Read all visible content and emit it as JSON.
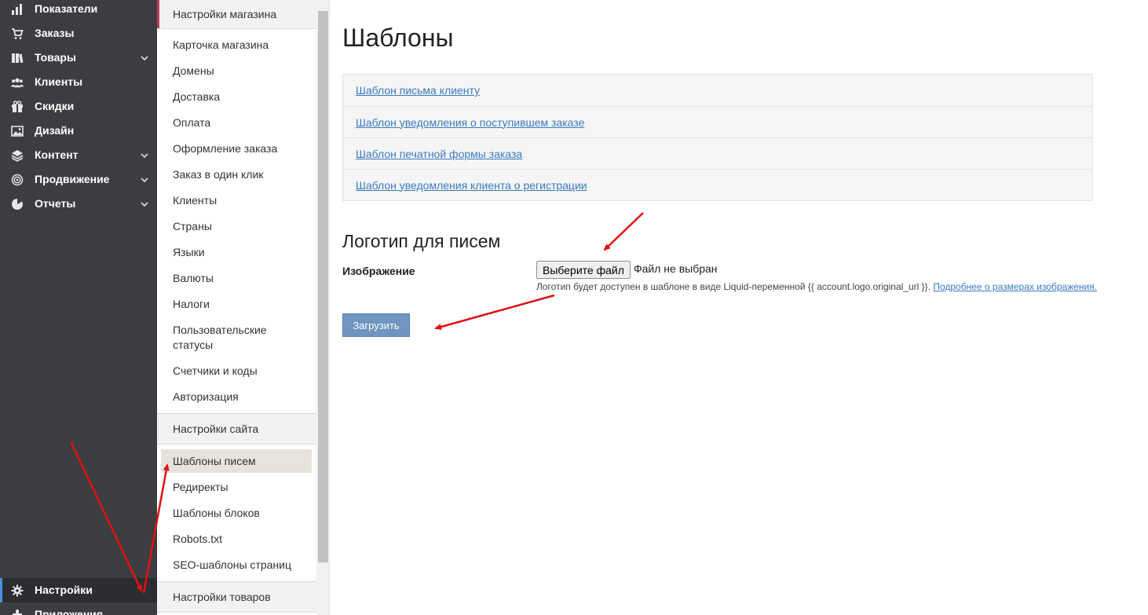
{
  "sidebar": {
    "items": [
      {
        "label": "Показатели",
        "icon": "bar-chart-icon",
        "chevron": false
      },
      {
        "label": "Заказы",
        "icon": "cart-icon",
        "chevron": false
      },
      {
        "label": "Товары",
        "icon": "books-icon",
        "chevron": true
      },
      {
        "label": "Клиенты",
        "icon": "users-icon",
        "chevron": false
      },
      {
        "label": "Скидки",
        "icon": "gift-icon",
        "chevron": false
      },
      {
        "label": "Дизайн",
        "icon": "image-icon",
        "chevron": false
      },
      {
        "label": "Контент",
        "icon": "layers-icon",
        "chevron": true
      },
      {
        "label": "Продвижение",
        "icon": "target-icon",
        "chevron": true
      },
      {
        "label": "Отчеты",
        "icon": "pie-chart-icon",
        "chevron": true
      }
    ],
    "settings_label": "Настройки",
    "apps_label": "Приложения",
    "accent_color": "#4a90e2"
  },
  "submenu": {
    "shop_section": "Настройки магазина",
    "shop_items": [
      "Карточка магазина",
      "Домены",
      "Доставка",
      "Оплата",
      "Оформление заказа",
      "Заказ в один клик",
      "Клиенты",
      "Страны",
      "Языки",
      "Валюты",
      "Налоги",
      "Пользовательские статусы",
      "Счетчики и коды",
      "Авторизация"
    ],
    "site_section": "Настройки сайта",
    "site_items": [
      "Шаблоны писем",
      "Редиректы",
      "Шаблоны блоков",
      "Robots.txt",
      "SEO-шаблоны страниц"
    ],
    "products_section": "Настройки товаров",
    "active_item": "Шаблоны писем"
  },
  "main": {
    "title": "Шаблоны",
    "templates": [
      "Шаблон письма клиенту",
      "Шаблон уведомления о поступившем заказе",
      "Шаблон печатной формы заказа",
      "Шаблон уведомления клиента о регистрации"
    ],
    "logo_section": "Логотип для писем",
    "image_label": "Изображение",
    "file_button": "Выберите файл",
    "file_status": "Файл не выбран",
    "hint_text": "Логотип будет доступен в шаблоне в виде Liquid-переменной {{ account.logo.original_url }}. ",
    "hint_link": "Подробнее о размерах изображения.",
    "upload_button": "Загрузить",
    "link_color": "#3a7bbf",
    "button_color": "#6f95c0"
  },
  "annotation_color": "#e01010"
}
